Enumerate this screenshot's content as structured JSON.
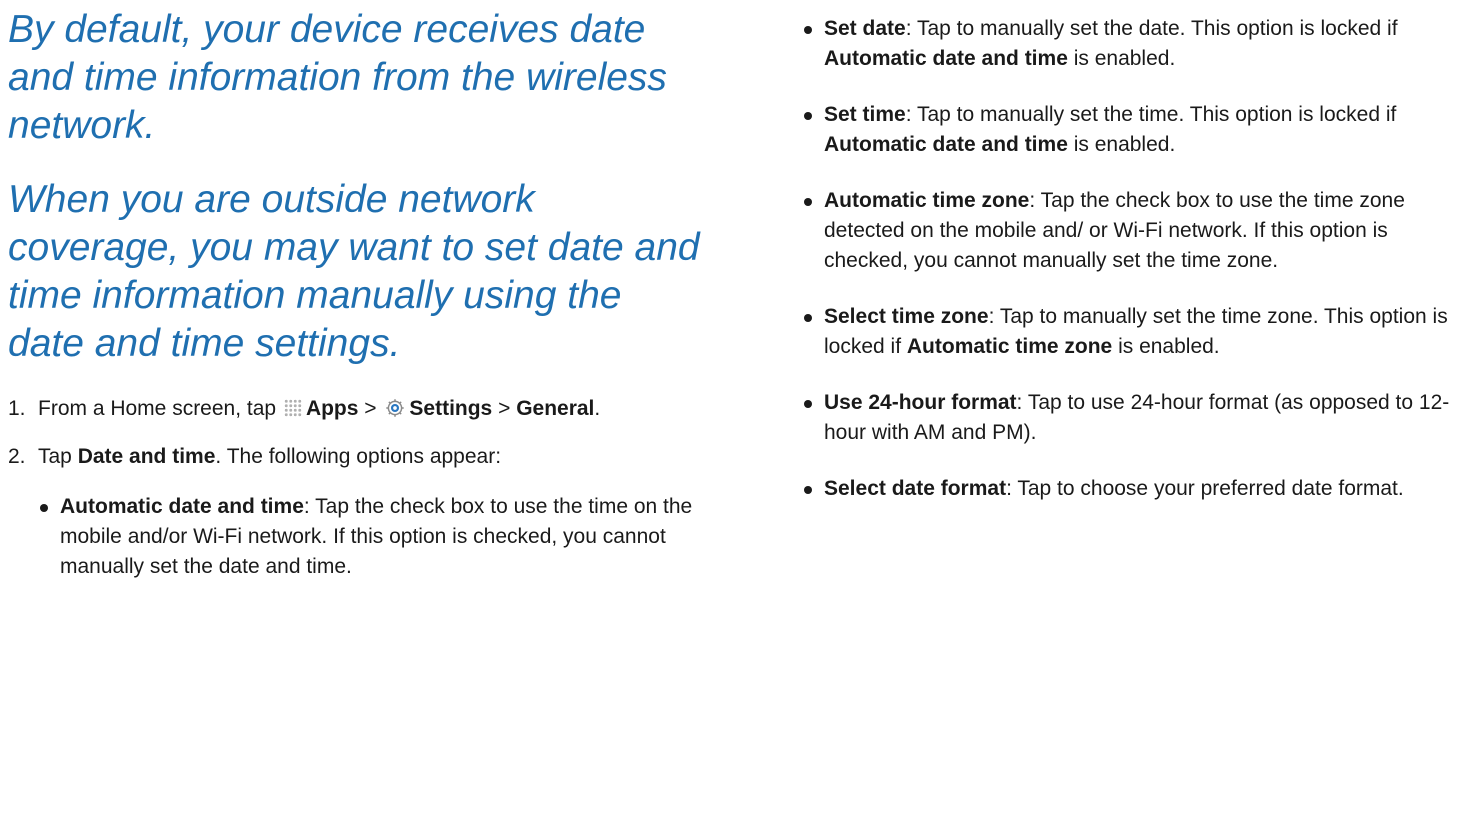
{
  "intro": {
    "p1": "By default, your device receives date and time information from the wireless network.",
    "p2": "When you are outside network coverage, you may want to set date and time information manually using the date and time settings."
  },
  "steps": [
    {
      "num": "1.",
      "t1": "From a Home screen, tap",
      "apps": "Apps",
      "gt1": ">",
      "settings": "Settings",
      "gt2": ">",
      "general": "General",
      "end": "."
    },
    {
      "num": "2.",
      "t1": "Tap",
      "bold": "Date and time",
      "t2": ". The following options appear:"
    }
  ],
  "options": [
    {
      "name": "Automatic date and time",
      "desc": ": Tap the check box to use the time on the mobile and/or Wi-Fi network. If this option is checked, you cannot manually set the date and time."
    },
    {
      "name": "Set date",
      "desc": ": Tap to manually set the date. This option is locked if ",
      "bold2": "Automatic date and time",
      "tail": " is enabled."
    },
    {
      "name": "Set time",
      "desc": ": Tap to manually set the time. This option is locked if ",
      "bold2": "Automatic date and time",
      "tail": " is enabled."
    },
    {
      "name": "Automatic time zone",
      "desc": ": Tap the check box to use the time zone detected on the mobile and/ or Wi-Fi network. If this option is checked, you cannot manually set the time zone."
    },
    {
      "name": "Select time zone",
      "desc": ": Tap to manually set the time zone. This option is locked if ",
      "bold2": "Automatic time zone",
      "tail": " is enabled."
    },
    {
      "name": "Use 24-hour format",
      "desc": ": Tap to use 24-hour format (as opposed to 12-hour with AM and PM)."
    },
    {
      "name": "Select date format",
      "desc": ": Tap to choose your preferred date format."
    }
  ],
  "icons": {
    "apps": "apps-grid-icon",
    "settings": "settings-gear-icon"
  },
  "colors": {
    "intro": "#1f6fb0",
    "body": "#1a1a1a"
  }
}
